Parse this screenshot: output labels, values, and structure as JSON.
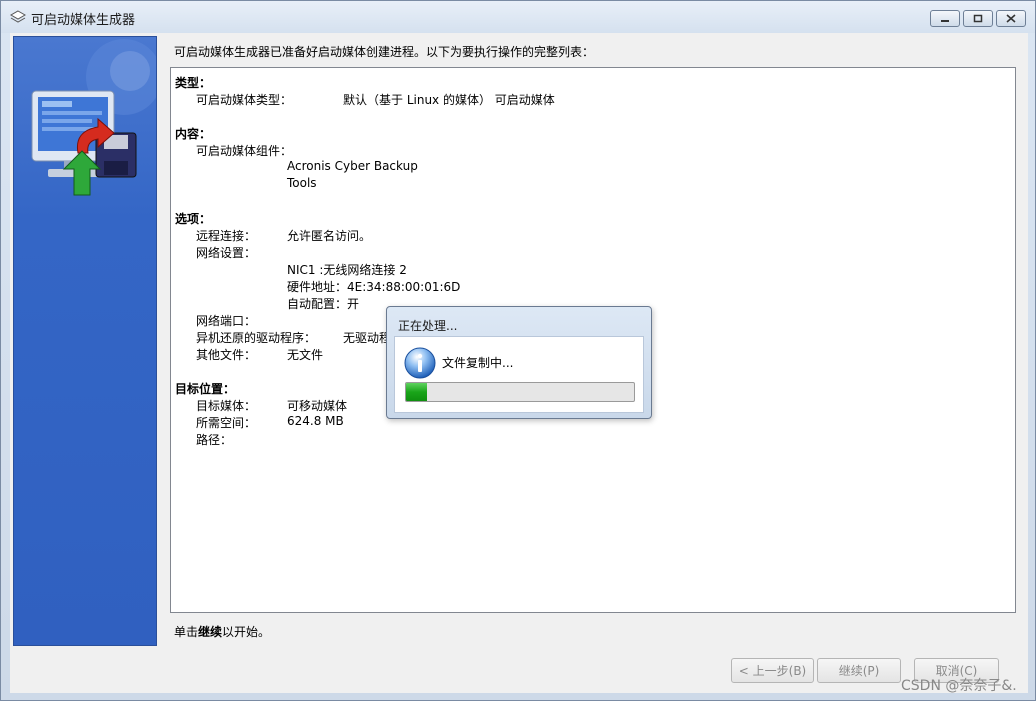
{
  "window": {
    "title": "可启动媒体生成器",
    "icon": "app-icon"
  },
  "content": {
    "header": "可启动媒体生成器已准备好启动媒体创建进程。以下为要执行操作的完整列表：",
    "sections": {
      "type": {
        "heading": "类型：",
        "media_type_label": "可启动媒体类型：",
        "media_type_value": "默认（基于 Linux 的媒体） 可启动媒体"
      },
      "contents": {
        "heading": "内容：",
        "components_label": "可启动媒体组件：",
        "components": [
          "Acronis Cyber Backup",
          "Tools"
        ]
      },
      "options": {
        "heading": "选项：",
        "remote_label": "远程连接：",
        "remote_value": "允许匿名访问。",
        "network_label": "网络设置：",
        "nic_name": "NIC1 :无线网络连接 2",
        "nic_mac": "硬件地址：4E:34:88:00:01:6D",
        "nic_auto": "自动配置：开",
        "port_label": "网络端口：",
        "driver_label": "异机还原的驱动程序：",
        "driver_value": "无驱动程",
        "other_label": "其他文件：",
        "other_value": "无文件"
      },
      "target": {
        "heading": "目标位置：",
        "media_label": "目标媒体：",
        "media_value": "可移动媒体",
        "space_label": "所需空间：",
        "space_value": "624.8 MB",
        "path_label": "路径："
      }
    },
    "footer_prefix": "单击",
    "footer_bold": "继续",
    "footer_suffix": "以开始。"
  },
  "buttons": {
    "back": "< 上一步(B)",
    "continue": "继续(P)",
    "cancel": "取消(C)"
  },
  "progress_dialog": {
    "title": "正在处理...",
    "message": "文件复制中...",
    "progress_fraction": 0.09
  },
  "watermark": "CSDN @奈奈子&."
}
